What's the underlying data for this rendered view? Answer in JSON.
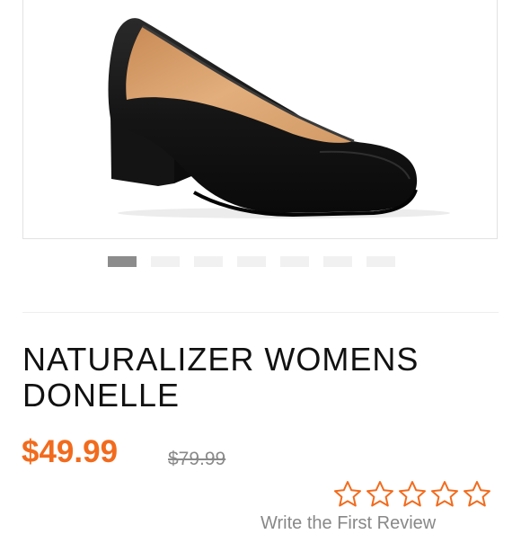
{
  "product": {
    "image_alt": "Black leather block-heel pump",
    "title": "NATURALIZER WOMENS DONELLE",
    "price": "$49.99",
    "original_price": "$79.99",
    "seller_line": "Write the First Review"
  },
  "carousel": {
    "total": 7,
    "active_index": 0
  },
  "rating": {
    "stars": 5,
    "value": 0,
    "star_color": "#f26b1d"
  },
  "colors": {
    "accent": "#f26b1d",
    "shoe_black": "#111111",
    "lining_tan": "#d9a06b"
  }
}
